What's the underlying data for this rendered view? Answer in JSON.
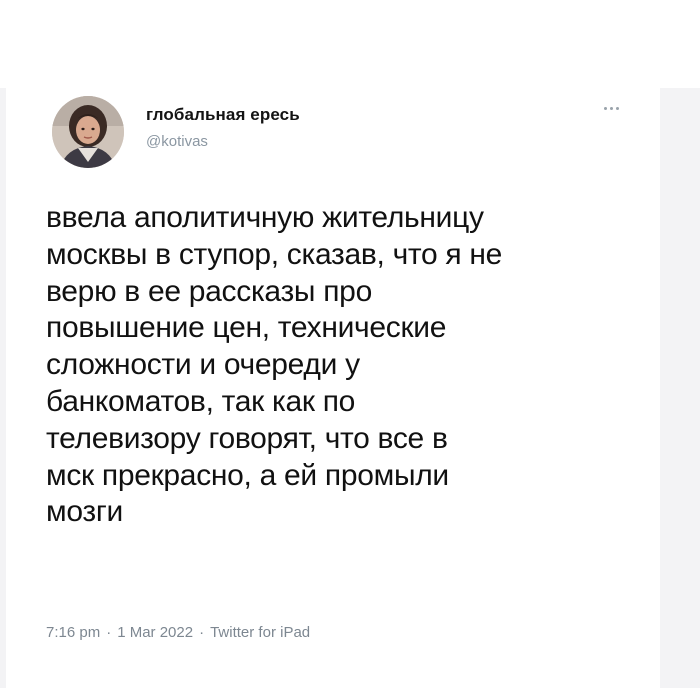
{
  "tweet": {
    "author": {
      "display_name": "глобальная ересь",
      "handle": "@kotivas",
      "avatar_icon": "avatar-photo"
    },
    "text": "ввела аполитичную жительницу\nмосквы в ступор, сказав, что я не\nверю в ее рассказы про\nповышение цен, технические\nсложности и очереди у\nбанкоматов, так как по\nтелевизору говорят, что все в\nмск прекрасно, а ей промыли\nмозги",
    "time": "7:16 pm",
    "date": "1 Mar 2022",
    "source": "Twitter for iPad",
    "separator": "·",
    "more_icon": "more-horizontal-icon"
  },
  "colors": {
    "text": "#111111",
    "muted": "#7d8791",
    "background": "#ffffff",
    "frame": "#f1f1f3"
  }
}
